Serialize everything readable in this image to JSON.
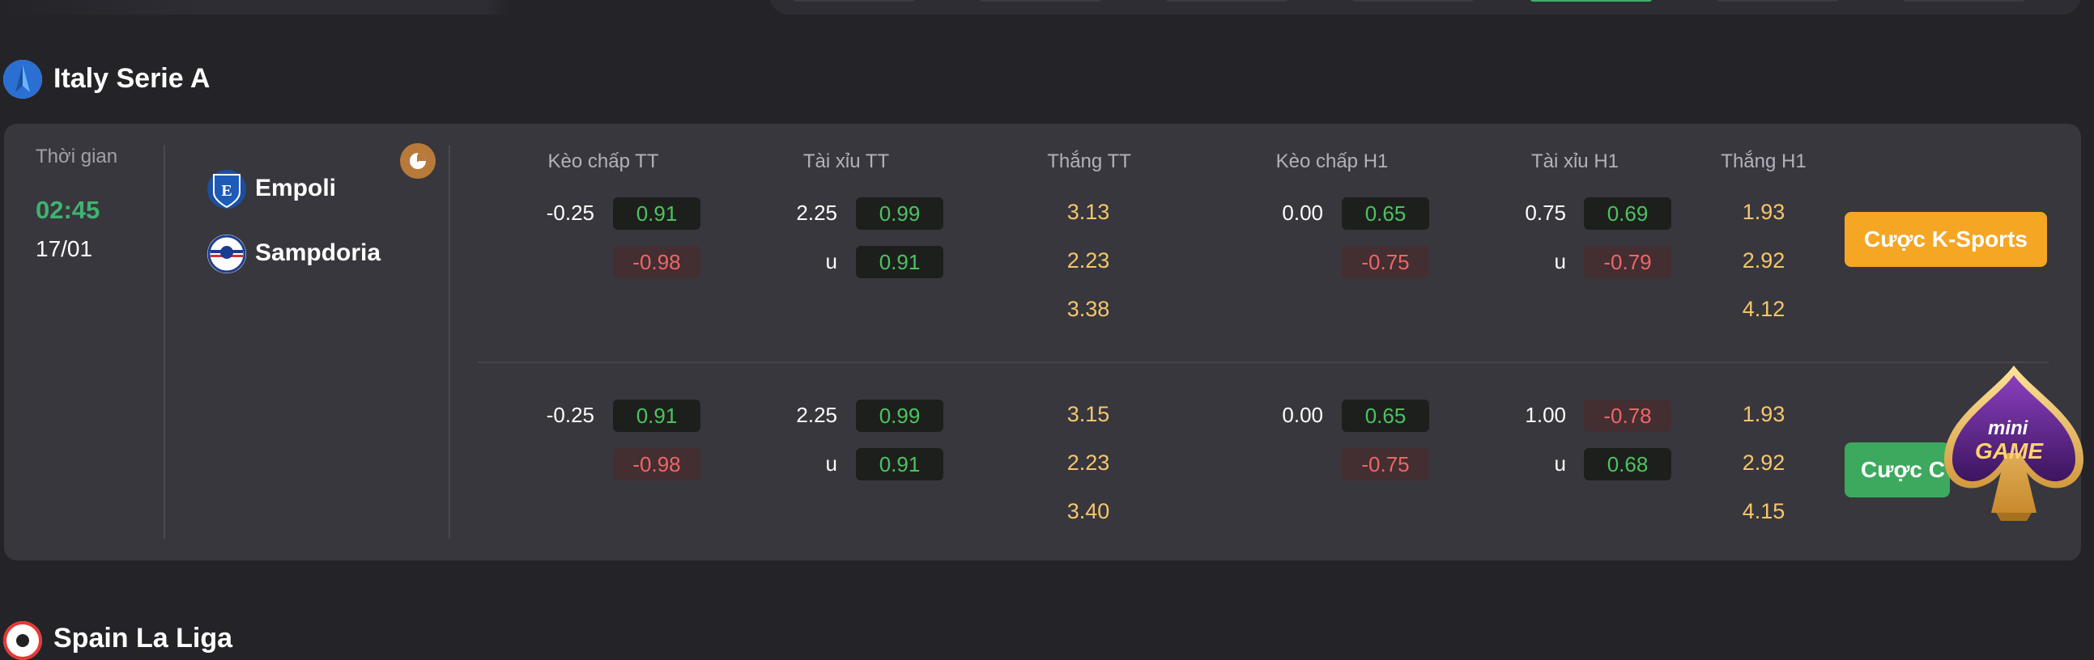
{
  "leagues": {
    "first": {
      "name": "Italy Serie A"
    },
    "second": {
      "name": "Spain La Liga"
    }
  },
  "match": {
    "time_label": "Thời gian",
    "time": "02:45",
    "date": "17/01",
    "home": "Empoli",
    "away": "Sampdoria"
  },
  "columns": [
    "Kèo chấp TT",
    "Tài xỉu TT",
    "Thắng TT",
    "Kèo chấp H1",
    "Tài xỉu H1",
    "Thắng H1"
  ],
  "rows": [
    {
      "hdp_line": "-0.25",
      "hdp_home": "0.91",
      "hdp_away": "-0.98",
      "ou_line": "2.25",
      "ou_under": "u",
      "ou_over_odd": "0.99",
      "ou_under_odd": "0.91",
      "win": [
        "3.13",
        "2.23",
        "3.38"
      ],
      "h1_hdp_line": "0.00",
      "h1_hdp_home": "0.65",
      "h1_hdp_away": "-0.75",
      "h1_ou_line": "0.75",
      "h1_ou_under": "u",
      "h1_ou_over_odd": "0.69",
      "h1_ou_under_odd": "-0.79",
      "h1_win": [
        "1.93",
        "2.92",
        "4.12"
      ]
    },
    {
      "hdp_line": "-0.25",
      "hdp_home": "0.91",
      "hdp_away": "-0.98",
      "ou_line": "2.25",
      "ou_under": "u",
      "ou_over_odd": "0.99",
      "ou_under_odd": "0.91",
      "win": [
        "3.15",
        "2.23",
        "3.40"
      ],
      "h1_hdp_line": "0.00",
      "h1_hdp_home": "0.65",
      "h1_hdp_away": "-0.75",
      "h1_ou_line": "1.00",
      "h1_ou_under": "u",
      "h1_ou_over_odd": "-0.78",
      "h1_ou_under_odd": "0.68",
      "h1_win": [
        "1.93",
        "2.92",
        "4.15"
      ]
    }
  ],
  "buttons": {
    "bet_ksports": "Cược K-Sports",
    "bet_partial": "Cược C"
  },
  "mini_game": {
    "line1": "mini",
    "line2": "GAME"
  },
  "colors": {
    "background": "#242328",
    "card": "#38373e",
    "accent_green": "#3fb370",
    "odd_positive": "#4cc35e",
    "odd_negative": "#f06565",
    "odd_plain": "#f6c66b",
    "bet_orange": "#f5a623"
  },
  "icons": {
    "league_italy": "serie-a-logo-icon",
    "league_spain": "laliga-logo-icon",
    "stats": "pie-chart-icon",
    "home_team": "empoli-crest-icon",
    "away_team": "sampdoria-crest-icon"
  }
}
